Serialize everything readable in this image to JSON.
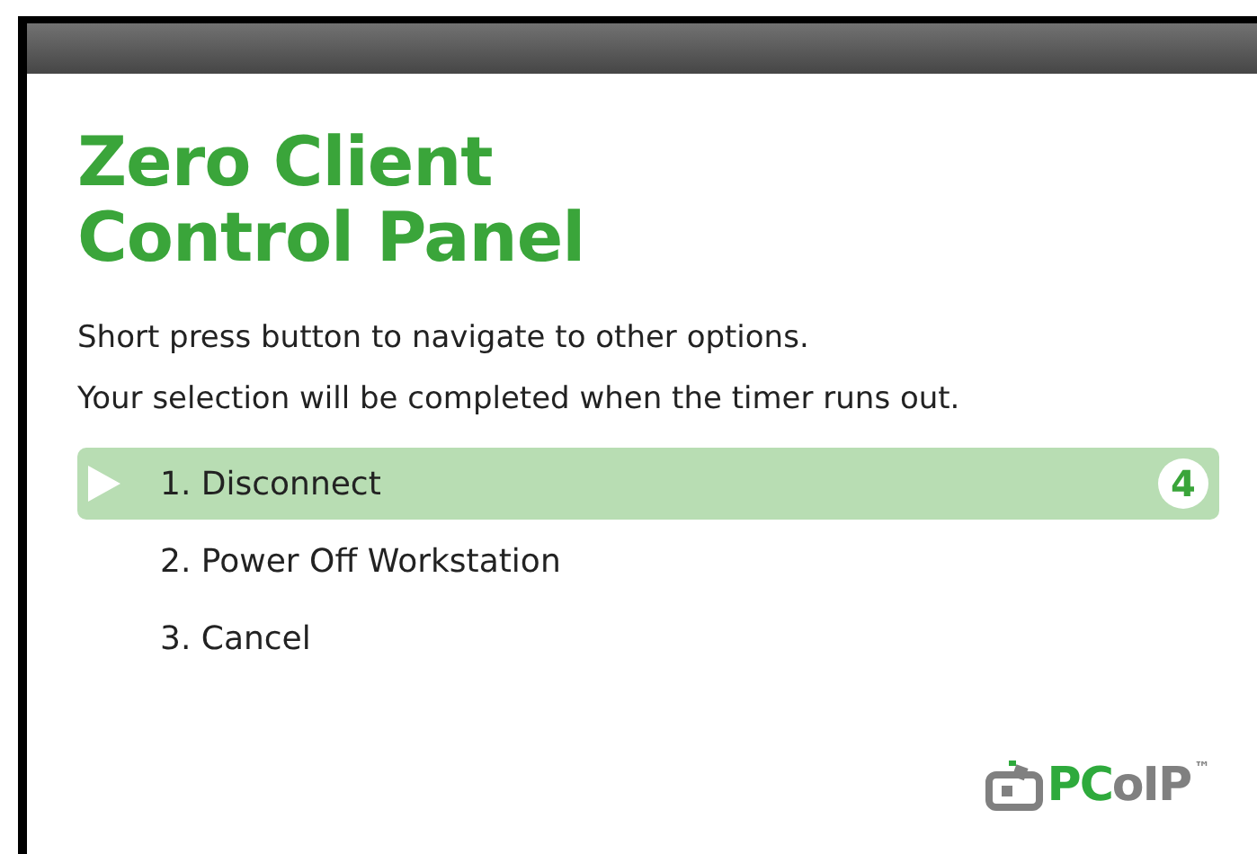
{
  "title_lines": [
    "Zero Client",
    "Control Panel"
  ],
  "instructions": [
    "Short press button to navigate to other options.",
    "Your selection will be completed when the timer runs out."
  ],
  "options": [
    {
      "label": "1. Disconnect",
      "selected": true,
      "countdown": "4"
    },
    {
      "label": "2. Power Off Workstation",
      "selected": false
    },
    {
      "label": "3. Cancel",
      "selected": false
    }
  ],
  "logo": [
    {
      "text": "PC",
      "color": "#2eaa3c"
    },
    {
      "text": "oIP",
      "color": "#808080"
    },
    {
      "text": "™",
      "color": "#808080"
    }
  ]
}
